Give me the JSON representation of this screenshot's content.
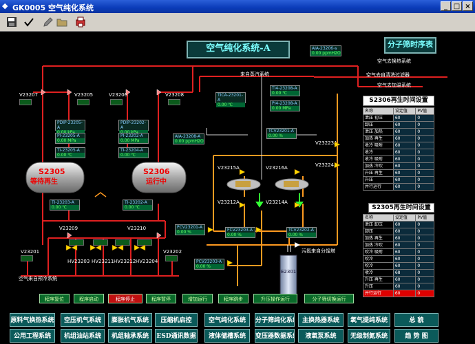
{
  "window": {
    "title": "GK0005 空气纯化系统"
  },
  "toolbar": {
    "buttons": [
      "save",
      "check",
      "edit",
      "open",
      "print"
    ]
  },
  "diagram": {
    "title": "空气纯化系统-A",
    "side_title": "分子筛时序表",
    "top_tag": {
      "name": "AIA-23206-s",
      "value": "0.00 ppmH2O"
    },
    "outputs": [
      "空气去换热系统",
      "空气去自清洗过滤器",
      "空气去加温系统"
    ],
    "input_label": "来自蒸汽系统",
    "bottom_left_label": "空气来自预冷系统",
    "bottom_right_label": "污氮来自分馏塔",
    "vessels": [
      {
        "id": "S2305",
        "status": "等待再生"
      },
      {
        "id": "S2306",
        "status": "运行中"
      }
    ],
    "heater_tag": "E2301",
    "valves": [
      "V23207",
      "V23205",
      "V23206",
      "V23208",
      "V23201",
      "V23202",
      "V23209",
      "V23210",
      "V23215A",
      "V23216A",
      "V23212A",
      "V23214A",
      "V23223A",
      "V23224A",
      "HV23203",
      "HV23211",
      "HV23212",
      "HV23204"
    ],
    "tags": [
      {
        "name": "PDIP-23205-A",
        "value": "0.00 kPa"
      },
      {
        "name": "PI-23205-A",
        "value": "0.00 MPa"
      },
      {
        "name": "TI-23205-A",
        "value": "0.00 ℃"
      },
      {
        "name": "PDIP-23202-A",
        "value": "0.00 kPa"
      },
      {
        "name": "PI-23202-A",
        "value": "0.00 MPa"
      },
      {
        "name": "TI-23204-A",
        "value": "0.00 ℃"
      },
      {
        "name": "AIA-23208-A",
        "value": "0.00 ppmH2O"
      },
      {
        "name": "TI-23203-A",
        "value": "0.00 ℃"
      },
      {
        "name": "TI-23202-A",
        "value": "0.00 ℃"
      },
      {
        "name": "TICA-23201-A",
        "value": "0.00 ℃"
      },
      {
        "name": "TI4-23208-A",
        "value": "0.00 ℃"
      },
      {
        "name": "PI4-23208-A",
        "value": "0.00 MPa"
      },
      {
        "name": "TCV23201-A",
        "value": "0.00 %"
      },
      {
        "name": "PCV23201-A",
        "value": "0.00 %"
      },
      {
        "name": "FCV23203-A",
        "value": "0.00 %"
      },
      {
        "name": "PCV23203-A",
        "value": "0.00 %"
      },
      {
        "name": "TCV23202-A",
        "value": "0.00 %"
      }
    ]
  },
  "table_s2306": {
    "title": "S2306再生时间设置",
    "headers": [
      "名称",
      "设定值",
      "PV值"
    ],
    "rows": [
      {
        "name": "泄压 初压",
        "set": "60",
        "pv": "0"
      },
      {
        "name": "卸压",
        "set": "60",
        "pv": "0"
      },
      {
        "name": "泄压 加热",
        "set": "60",
        "pv": "0"
      },
      {
        "name": "加热 再生",
        "set": "60",
        "pv": "0"
      },
      {
        "name": "收冷 吸附",
        "set": "60",
        "pv": "0"
      },
      {
        "name": "收冷",
        "set": "60",
        "pv": "0"
      },
      {
        "name": "收冷 吸附",
        "set": "60",
        "pv": "0"
      },
      {
        "name": "加热 冷吹",
        "set": "60",
        "pv": "0"
      },
      {
        "name": "升压 再生",
        "set": "60",
        "pv": "0"
      },
      {
        "name": "升压",
        "set": "60",
        "pv": "0"
      },
      {
        "name": "并行运行",
        "set": "60",
        "pv": "0"
      }
    ]
  },
  "table_s2305": {
    "title": "S2305再生时间设置",
    "headers": [
      "名称",
      "设定值",
      "PV值"
    ],
    "rows": [
      {
        "name": "泄压 卸压",
        "set": "60",
        "pv": "0"
      },
      {
        "name": "卸压",
        "set": "60",
        "pv": "0"
      },
      {
        "name": "加热 再生",
        "set": "60",
        "pv": "0"
      },
      {
        "name": "加热 冷吹",
        "set": "60",
        "pv": "0"
      },
      {
        "name": "吹冷 吸附",
        "set": "60",
        "pv": "0"
      },
      {
        "name": "吹冷",
        "set": "60",
        "pv": "0"
      },
      {
        "name": "吹冷",
        "set": "60",
        "pv": "0"
      },
      {
        "name": "收冷",
        "set": "68",
        "pv": "0"
      },
      {
        "name": "升压 再生",
        "set": "60",
        "pv": "0"
      },
      {
        "name": "升压",
        "set": "60",
        "pv": "0"
      },
      {
        "name": "并行运行",
        "set": "60",
        "pv": "0"
      }
    ],
    "highlight_row": 10
  },
  "control_buttons": [
    {
      "label": "程序复位",
      "color": "green"
    },
    {
      "label": "程序启动",
      "color": "green"
    },
    {
      "label": "程序停止",
      "color": "red"
    },
    {
      "label": "程序暂停",
      "color": "green"
    },
    {
      "label": "增加运行",
      "color": "green"
    },
    {
      "label": "程序跳步",
      "color": "green"
    },
    {
      "label": "升压操作运行",
      "color": "green"
    },
    {
      "label": "分子筛切换运行",
      "color": "green"
    }
  ],
  "nav_row1": [
    "原料气换热系统",
    "空压机气系统",
    "膨胀机气系统",
    "压缩机启控",
    "空气纯化系统",
    "分子筛纯化系统",
    "主换热器系统",
    "氧气提纯系统",
    "总 貌"
  ],
  "nav_row2": [
    "公用工程系统",
    "机组油站系统",
    "机组轴承系统",
    "ESD通讯数据",
    "液体储槽系统",
    "变压器数据系统",
    "液氧泵系统",
    "无级制氮系统",
    "趋 势 图"
  ]
}
